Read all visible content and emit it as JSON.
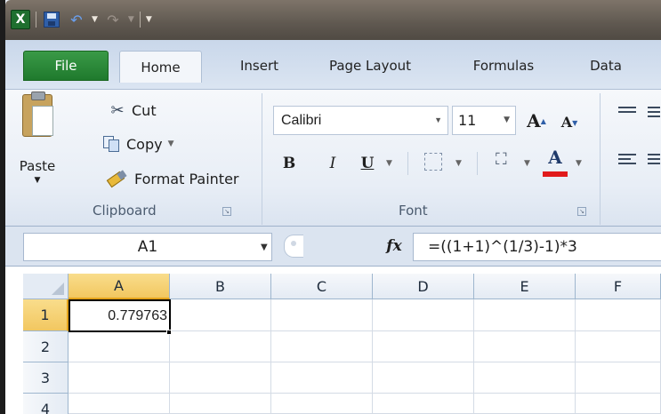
{
  "app": {
    "name": "Microsoft Excel",
    "logo_letter": "X"
  },
  "tabs": [
    {
      "id": "file",
      "label": "File"
    },
    {
      "id": "home",
      "label": "Home"
    },
    {
      "id": "insert",
      "label": "Insert"
    },
    {
      "id": "page_layout",
      "label": "Page Layout"
    },
    {
      "id": "formulas",
      "label": "Formulas"
    },
    {
      "id": "data",
      "label": "Data"
    }
  ],
  "ribbon": {
    "clipboard": {
      "group_label": "Clipboard",
      "paste_label": "Paste",
      "cut_label": "Cut",
      "copy_label": "Copy",
      "format_painter_label": "Format Painter"
    },
    "font": {
      "group_label": "Font",
      "font_name": "Calibri",
      "font_size": "11",
      "bold_glyph": "B",
      "italic_glyph": "I",
      "underline_glyph": "U",
      "grow_glyph": "A",
      "shrink_glyph": "A",
      "font_color_glyph": "A",
      "font_color": "#e11b1b"
    }
  },
  "formula_bar": {
    "name_box": "A1",
    "fx_label": "fx",
    "formula": "=((1+1)^(1/3)-1)*3"
  },
  "sheet": {
    "columns": [
      "A",
      "B",
      "C",
      "D",
      "E",
      "F"
    ],
    "rows": [
      "1",
      "2",
      "3",
      "4"
    ],
    "active_cell": "A1",
    "cells": {
      "A1": "0.779763"
    }
  },
  "icons": {
    "save": "save-icon",
    "undo": "undo-icon",
    "redo": "redo-icon",
    "cut": "scissors-icon",
    "copy": "copy-icon",
    "format_painter": "paintbrush-icon",
    "fill_color": "paint-bucket-icon",
    "borders": "borders-icon"
  }
}
